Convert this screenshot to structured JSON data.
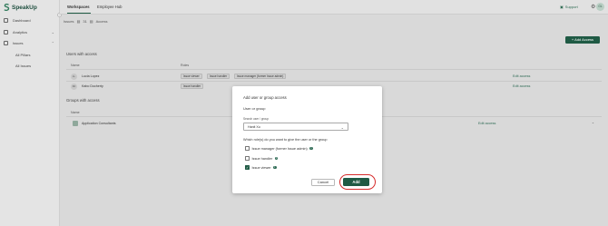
{
  "app": {
    "name": "SpeakUp"
  },
  "sidebar": {
    "items": [
      {
        "label": "Dashboard"
      },
      {
        "label": "Analytics"
      },
      {
        "label": "Issues"
      }
    ],
    "sub_items": [
      {
        "label": "All Pillars"
      },
      {
        "label": "All Issues"
      }
    ]
  },
  "topbar": {
    "tabs": [
      {
        "label": "Workspaces"
      },
      {
        "label": "Employee Hub"
      }
    ],
    "support_label": "Support",
    "avatar_initials": "GL"
  },
  "breadcrumb": {
    "parent": "Issues",
    "id": "31",
    "current": "Access"
  },
  "add_access_button": "+ Add Access",
  "users_section": {
    "title": "Users with access",
    "headers": {
      "name": "Name",
      "roles": "Roles"
    },
    "rows": [
      {
        "initials": "LL",
        "name": "Lucia Lopez",
        "roles": [
          "Issue viewer",
          "Issue handler",
          "Issue manager (former Issue admin)"
        ],
        "action": "Edit access"
      },
      {
        "initials": "KD",
        "name": "Kabo Docherty",
        "roles": [
          "Issue handler"
        ],
        "action": "Edit access"
      }
    ]
  },
  "groups_section": {
    "title": "Groups with access",
    "headers": {
      "name": "Name"
    },
    "rows": [
      {
        "name": "Application Consultants",
        "action": "Edit access"
      }
    ]
  },
  "modal": {
    "title": "Add user or group access",
    "subtitle": "User or group",
    "search_label": "Search user / group",
    "search_value": "Hanit Xu",
    "question": "Which role(s) do you want to give the user or the group",
    "options": [
      {
        "label": "Issue manager (former Issue admin)",
        "checked": false
      },
      {
        "label": "Issue handler",
        "checked": false
      },
      {
        "label": "Issue viewer",
        "checked": true
      }
    ],
    "cancel_label": "Cancel",
    "add_label": "Add"
  },
  "colors": {
    "brand": "#1f5a44",
    "highlight": "#d62b2b"
  }
}
